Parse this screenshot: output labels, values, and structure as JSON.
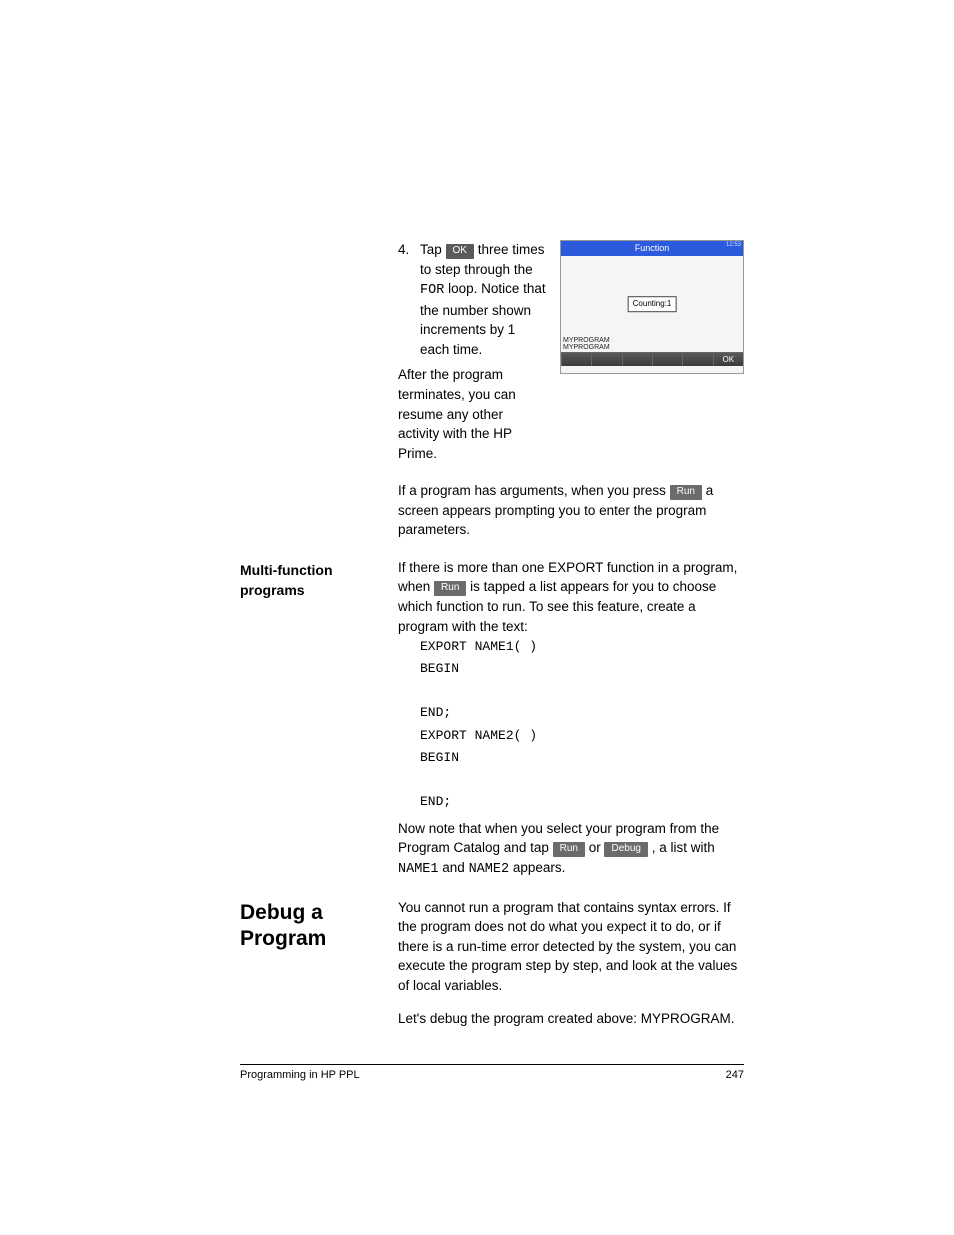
{
  "step4": {
    "num": "4.",
    "pre": "Tap ",
    "btn": "OK",
    "post1": " three times to step through the ",
    "code": "FOR",
    "post2": " loop. Notice that the number shown increments by 1 each time."
  },
  "afterProg": "After the program terminates, you can resume any other activity with the HP Prime.",
  "argsPara": {
    "pre": "If a program has arguments, when you press ",
    "btn": "Run",
    "post": " a screen appears prompting you to enter the program parameters."
  },
  "multi": {
    "heading": "Multi-function programs",
    "p1_pre": "If there is more than one EXPORT function in a program, when ",
    "p1_btn": "Run",
    "p1_post": " is tapped a list appears for you to choose which function to run. To see this feature, create a program with the text:",
    "code": "EXPORT NAME1( )\nBEGIN\n\nEND;\nEXPORT NAME2( )\nBEGIN\n\nEND;",
    "p2_pre": "Now note that when you select your program from the Program Catalog and tap ",
    "p2_btn1": "Run",
    "p2_or": " or ",
    "p2_btn2": "Debug",
    "p2_post1": ", a list with ",
    "p2_code1": "NAME1",
    "p2_and": " and ",
    "p2_code2": "NAME2",
    "p2_post2": " appears."
  },
  "debug": {
    "heading": "Debug a Program",
    "p1": "You cannot run a program that contains syntax errors. If the program does not do what you expect it to do, or if there is a run-time error detected by the system, you can execute the program step by step, and look at the values of local variables.",
    "p2": "Let's debug the program created above: MYPROGRAM."
  },
  "calc": {
    "title": "Function",
    "time": "12:53",
    "msg": "Counting:1",
    "hist1": "MYPROGRAM",
    "hist2": "MYPROGRAM",
    "ok": "OK"
  },
  "footer": {
    "left": "Programming in HP PPL",
    "right": "247"
  }
}
